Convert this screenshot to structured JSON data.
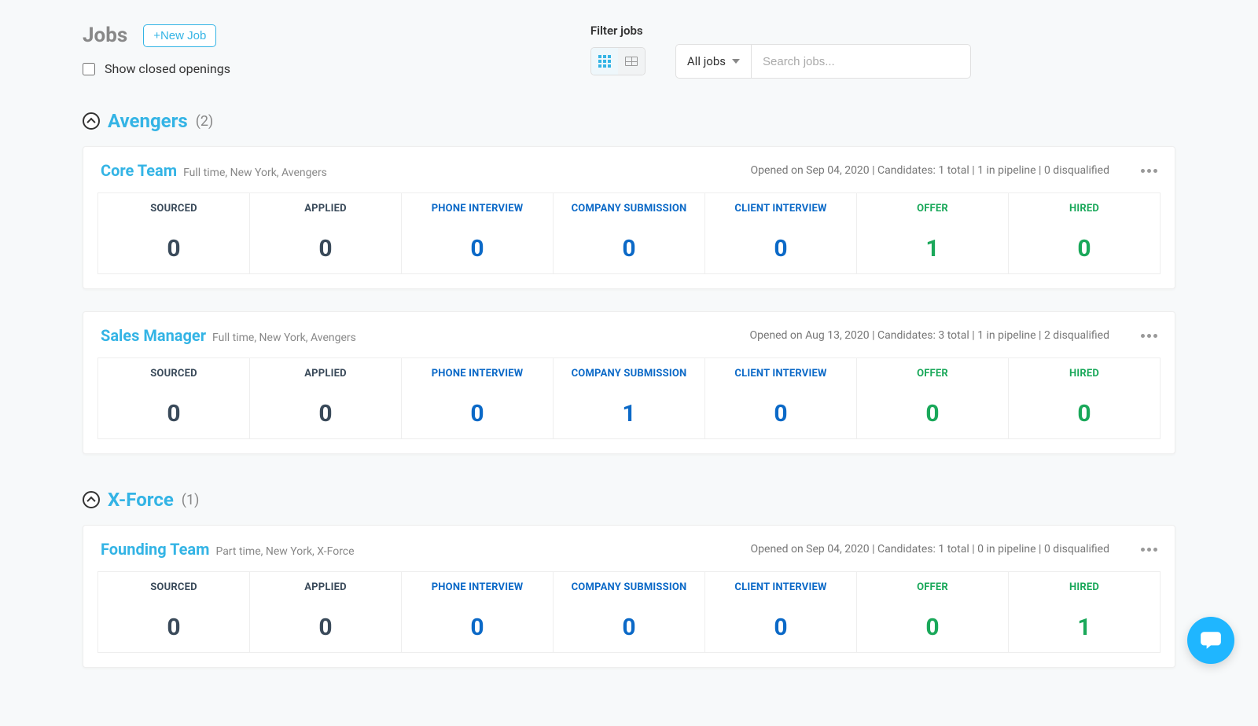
{
  "header": {
    "title": "Jobs",
    "new_button": "+New Job",
    "show_closed_label": "Show closed openings"
  },
  "filter": {
    "label": "Filter jobs",
    "select_value": "All jobs",
    "search_placeholder": "Search jobs..."
  },
  "stage_labels": [
    "SOURCED",
    "APPLIED",
    "PHONE INTERVIEW",
    "COMPANY SUBMISSION",
    "CLIENT INTERVIEW",
    "OFFER",
    "HIRED"
  ],
  "stage_colors": [
    "gray",
    "gray",
    "blue",
    "blue",
    "blue",
    "green",
    "green"
  ],
  "groups": [
    {
      "name": "Avengers",
      "count": "(2)",
      "jobs": [
        {
          "title": "Core Team",
          "subtitle": "Full time, New York, Avengers",
          "meta": "Opened on Sep 04, 2020 | Candidates: 1 total | 1 in pipeline | 0 disqualified",
          "counts": [
            "0",
            "0",
            "0",
            "0",
            "0",
            "1",
            "0"
          ]
        },
        {
          "title": "Sales Manager",
          "subtitle": "Full time, New York, Avengers",
          "meta": "Opened on Aug 13, 2020 | Candidates: 3 total | 1 in pipeline | 2 disqualified",
          "counts": [
            "0",
            "0",
            "0",
            "1",
            "0",
            "0",
            "0"
          ]
        }
      ]
    },
    {
      "name": "X-Force",
      "count": "(1)",
      "jobs": [
        {
          "title": "Founding Team",
          "subtitle": "Part time, New York, X-Force",
          "meta": "Opened on Sep 04, 2020 | Candidates: 1 total | 0 in pipeline | 0 disqualified",
          "counts": [
            "0",
            "0",
            "0",
            "0",
            "0",
            "0",
            "1"
          ]
        }
      ]
    }
  ]
}
